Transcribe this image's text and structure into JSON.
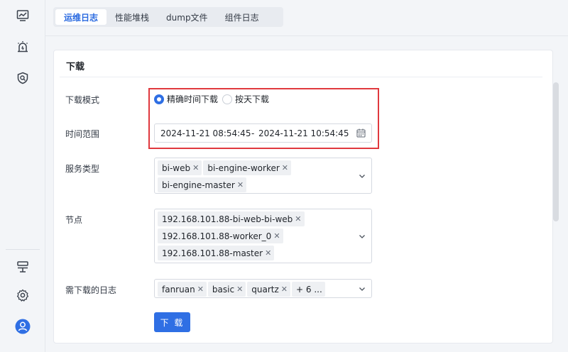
{
  "rail": {
    "icons": [
      "monitor-chart-icon",
      "alarm-icon",
      "search-shield-icon",
      "layout-icon",
      "gear-icon",
      "user-avatar-icon"
    ]
  },
  "tabs": [
    {
      "label": "运维日志",
      "active": true
    },
    {
      "label": "性能堆栈",
      "active": false
    },
    {
      "label": "dump文件",
      "active": false
    },
    {
      "label": "组件日志",
      "active": false
    }
  ],
  "card": {
    "title": "下载"
  },
  "form": {
    "mode": {
      "label": "下载模式",
      "options": [
        {
          "label": "精确时间下载",
          "checked": true
        },
        {
          "label": "按天下载",
          "checked": false
        }
      ]
    },
    "time_range": {
      "label": "时间范围",
      "start": "2024-11-21 08:54:45",
      "separator": "-",
      "end": "2024-11-21 10:54:45"
    },
    "service_type": {
      "label": "服务类型",
      "tags": [
        "bi-web",
        "bi-engine-worker",
        "bi-engine-master"
      ]
    },
    "node": {
      "label": "节点",
      "tags": [
        "192.168.101.88-bi-web-bi-web",
        "192.168.101.88-worker_0",
        "192.168.101.88-master"
      ]
    },
    "logs": {
      "label": "需下载的日志",
      "tags": [
        "fanruan",
        "basic",
        "quartz"
      ],
      "more": "+ 6 ..."
    },
    "submit_label": "下 载"
  },
  "colors": {
    "accent": "#2f6fe4",
    "highlight": "#e0393e"
  }
}
